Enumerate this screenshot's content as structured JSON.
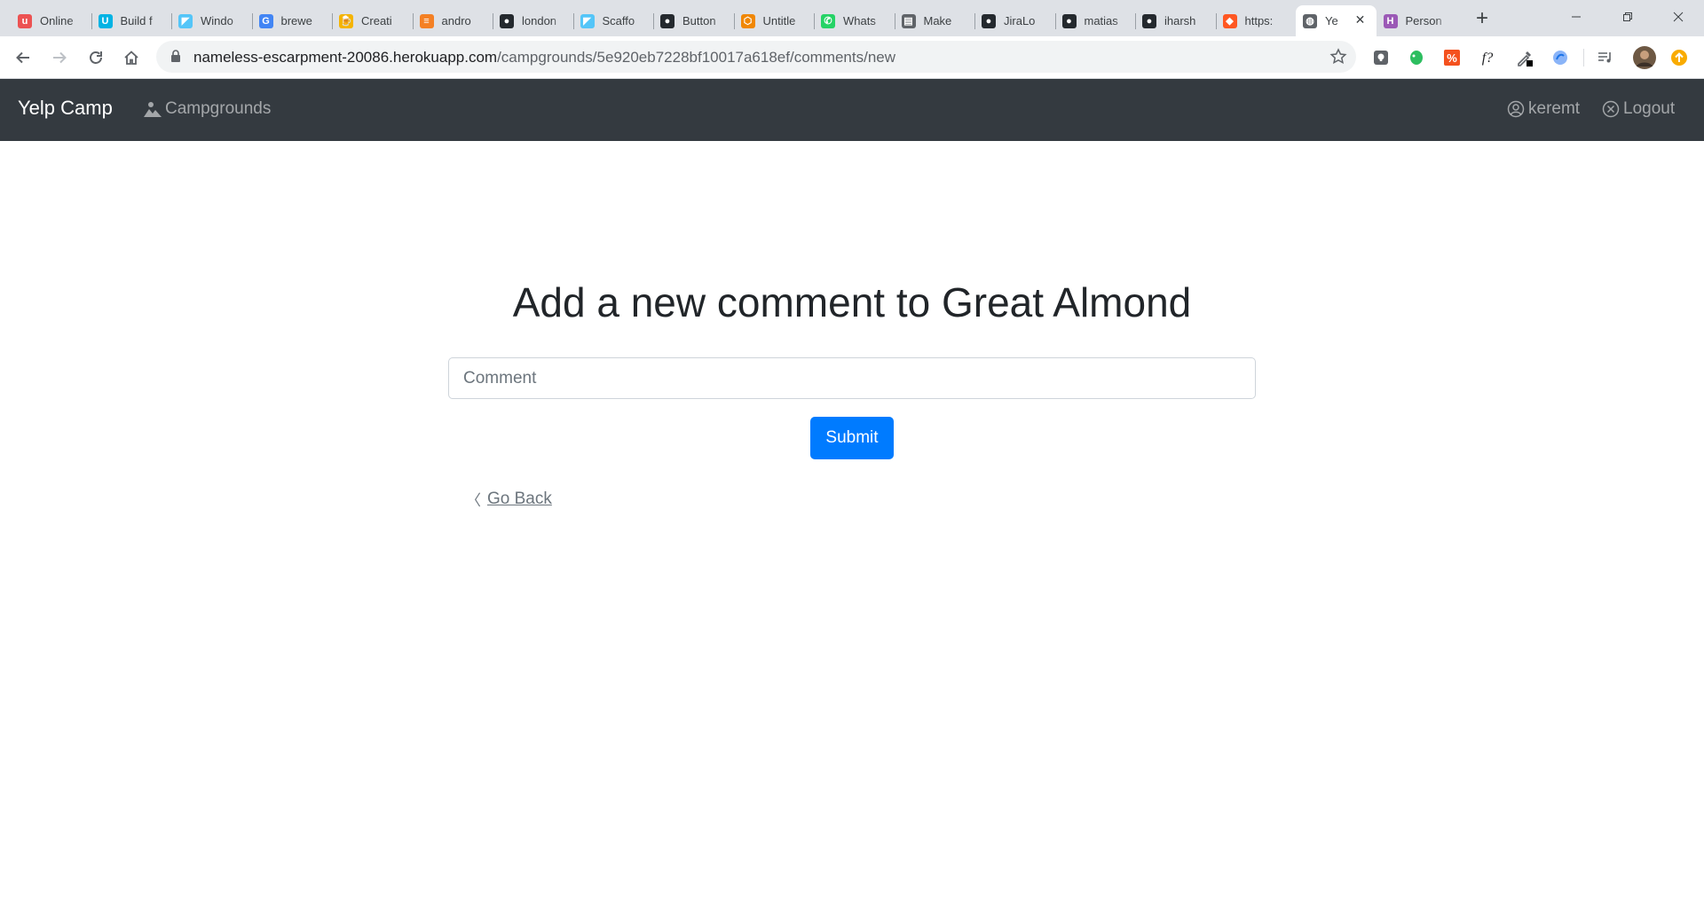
{
  "browser": {
    "tabs": [
      {
        "title": "Online",
        "icon": "udemy-icon",
        "color": "#ec5252"
      },
      {
        "title": "Build f",
        "icon": "udacity-icon",
        "color": "#02b3e4"
      },
      {
        "title": "Windo",
        "icon": "flutter-icon",
        "color": "#54c5f8"
      },
      {
        "title": "brewe",
        "icon": "google-icon",
        "color": "#4285f4"
      },
      {
        "title": "Creati",
        "icon": "beer-icon",
        "color": "#f5b400"
      },
      {
        "title": "andro",
        "icon": "stackoverflow-icon",
        "color": "#f48024"
      },
      {
        "title": "london",
        "icon": "github-icon",
        "color": "#24292e"
      },
      {
        "title": "Scaffo",
        "icon": "flutter-icon",
        "color": "#54c5f8"
      },
      {
        "title": "Button",
        "icon": "github-icon",
        "color": "#24292e"
      },
      {
        "title": "Untitle",
        "icon": "drawio-icon",
        "color": "#f08705"
      },
      {
        "title": "Whats",
        "icon": "whatsapp-icon",
        "color": "#25d366"
      },
      {
        "title": "Make",
        "icon": "document-icon",
        "color": "#5f6368"
      },
      {
        "title": "JiraLo",
        "icon": "github-icon",
        "color": "#24292e"
      },
      {
        "title": "matias",
        "icon": "github-icon",
        "color": "#24292e"
      },
      {
        "title": "iharsh",
        "icon": "github-icon",
        "color": "#24292e"
      },
      {
        "title": "https:",
        "icon": "codelab-icon",
        "color": "#ff5722"
      },
      {
        "title": "Ye",
        "icon": "globe-icon",
        "color": "#5f6368",
        "active": true
      },
      {
        "title": "Person",
        "icon": "hashnode-icon",
        "color": "#9b59b6"
      }
    ],
    "url_host": "nameless-escarpment-20086.herokuapp.com",
    "url_path": "/campgrounds/5e920eb7228bf10017a618ef/comments/new"
  },
  "navbar": {
    "brand": "Yelp Camp",
    "campgrounds": "Campgrounds",
    "user": "keremt",
    "logout": "Logout"
  },
  "main": {
    "heading": "Add a new comment to Great Almond",
    "comment_placeholder": "Comment",
    "submit_label": "Submit",
    "back_chevron": "〈",
    "go_back_label": "Go Back"
  },
  "colors": {
    "navbar_bg": "#343a40",
    "primary": "#007bff"
  }
}
